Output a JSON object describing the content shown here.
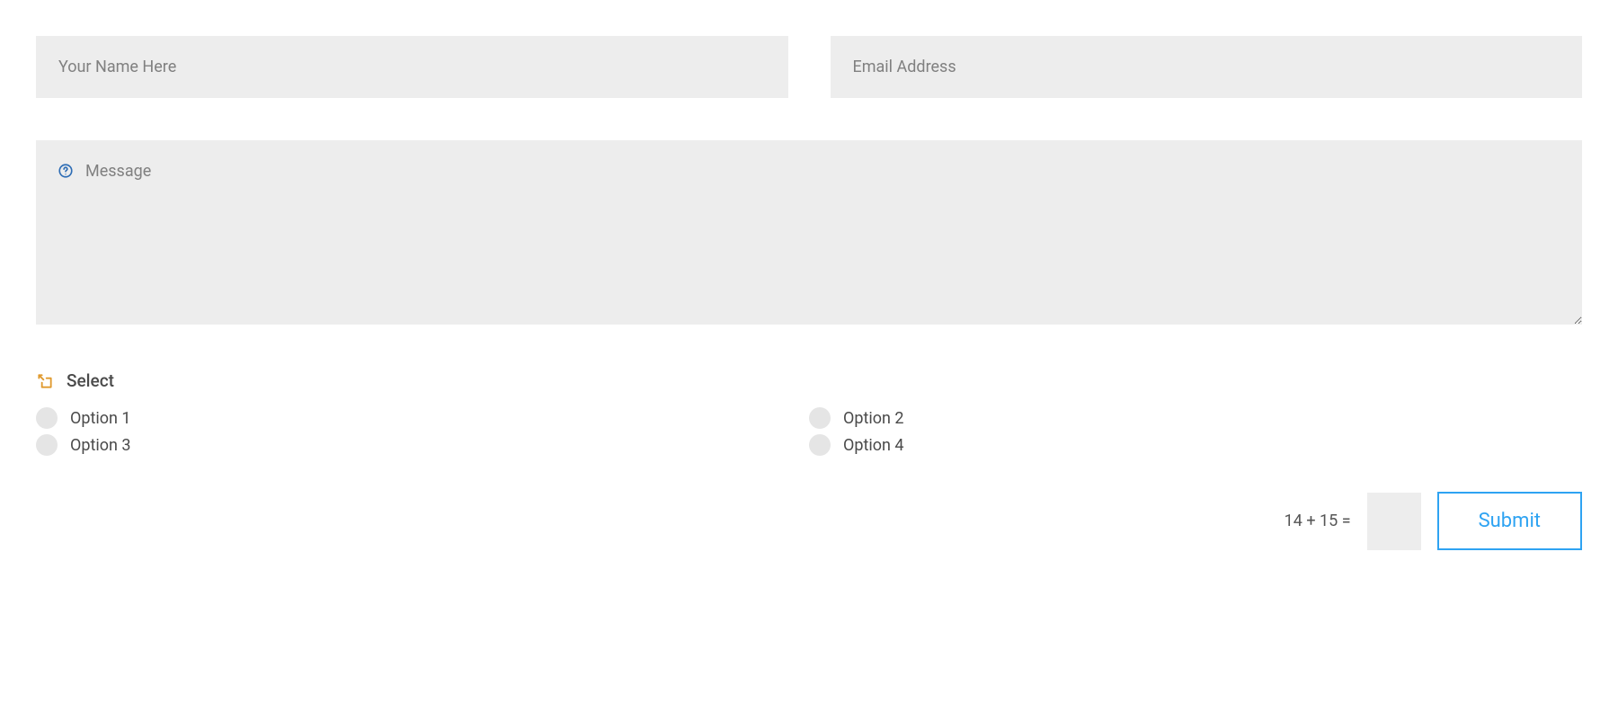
{
  "form": {
    "name": {
      "placeholder": "Your Name Here",
      "value": ""
    },
    "email": {
      "placeholder": "Email Address",
      "value": ""
    },
    "message": {
      "placeholder": "Message",
      "value": ""
    },
    "select": {
      "label": "Select",
      "options": [
        "Option 1",
        "Option 2",
        "Option 3",
        "Option 4"
      ]
    },
    "captcha": {
      "question": "14 + 15 =",
      "value": ""
    },
    "submit_label": "Submit"
  },
  "colors": {
    "accent": "#2ea3f2",
    "field_bg": "#ededed",
    "icon_orange": "#e09a2f",
    "icon_blue": "#2e6db5"
  }
}
